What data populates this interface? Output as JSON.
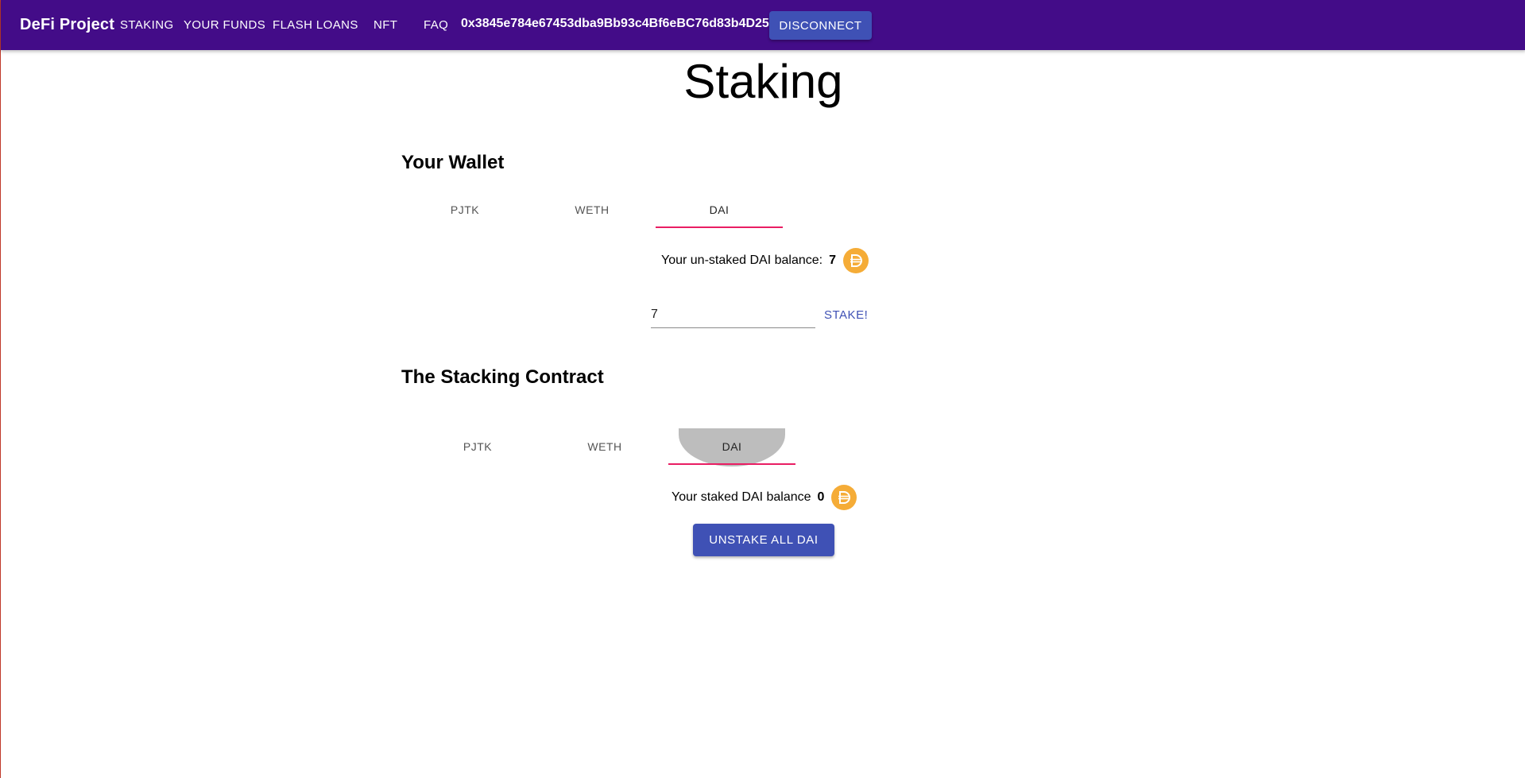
{
  "colors": {
    "brand": "#430c88",
    "primary": "#3f51b5",
    "accent": "#e91e63",
    "coin": "#f5ac37"
  },
  "appbar": {
    "brand": "DeFi Project",
    "nav": [
      "STAKING",
      "YOUR FUNDS",
      "FLASH LOANS",
      "NFT",
      "FAQ"
    ],
    "address": "0x3845e784e67453dba9Bb93c4Bf6eBC76d83b4D25",
    "disconnect_label": "DISCONNECT"
  },
  "page": {
    "title": "Staking"
  },
  "wallet": {
    "heading": "Your Wallet",
    "tabs": [
      "PJTK",
      "WETH",
      "DAI"
    ],
    "selected_tab": "DAI",
    "balance_label": "Your un-staked DAI balance:",
    "balance_value": "7",
    "coin_icon": "dai-coin-icon",
    "input_value": "7",
    "stake_label": "STAKE!"
  },
  "contract": {
    "heading": "The Stacking Contract",
    "tabs": [
      "PJTK",
      "WETH",
      "DAI"
    ],
    "selected_tab": "DAI",
    "balance_label": "Your staked DAI balance",
    "balance_value": "0",
    "coin_icon": "dai-coin-icon",
    "unstake_label": "UNSTAKE ALL DAI"
  }
}
